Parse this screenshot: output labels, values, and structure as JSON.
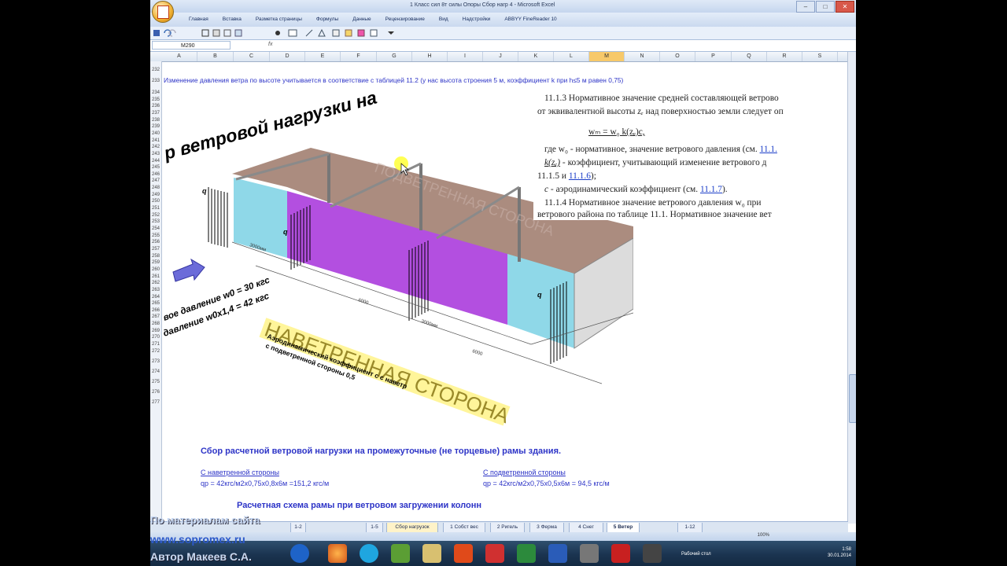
{
  "window": {
    "title": "1 Класс сил 8т силы Опоры Сбор нагр 4 - Microsoft Excel",
    "tabs": [
      "Главная",
      "Вставка",
      "Разметка страницы",
      "Формулы",
      "Данные",
      "Рецензирование",
      "Вид",
      "Надстройки",
      "ABBYY FineReader 10"
    ]
  },
  "formula_bar": {
    "name_box": "M290",
    "fx": "fx",
    "formula": ""
  },
  "columns": [
    "A",
    "B",
    "C",
    "D",
    "E",
    "F",
    "G",
    "H",
    "I",
    "J",
    "K",
    "L",
    "M",
    "N",
    "O",
    "P",
    "Q",
    "R",
    "S"
  ],
  "selected_column": "M",
  "rows": [
    "232",
    "233",
    "234",
    "235",
    "236",
    "237",
    "238",
    "239",
    "240",
    "241",
    "242",
    "243",
    "244",
    "245",
    "246",
    "247",
    "248",
    "249",
    "250",
    "251",
    "252",
    "253",
    "254",
    "255",
    "256",
    "257",
    "258",
    "259",
    "260",
    "261",
    "262",
    "263",
    "264",
    "265",
    "266",
    "267",
    "268",
    "269",
    "270",
    "271",
    "272",
    "273",
    "274",
    "275",
    "276",
    "277"
  ],
  "sheet": {
    "note_233": "Изменение давления ветра по высоте учитывается в соответствие с таблицей 11.2 (у нас высота строения 5 м, коэффициент k при h≤5 м равен 0,75)",
    "figure": {
      "title": "р ветровой нагрузки на",
      "pressure_1": "вое давление w0 = 30 кгс",
      "pressure_2": "давление w0x1,4 = 42 кгс",
      "banner": "НАВЕТРЕННАЯ СТОРОНА",
      "banner_faint": "ПОДВЕТРЕННАЯ СТОРОНА",
      "coef_1": "Аэродинамический коэффициент с с наветр",
      "coef_2": "с подветренной стороны 0,5",
      "dim_3000": "3000мм",
      "dim_6000": "6000",
      "q_label": "q"
    },
    "doc": {
      "p1": "11.1.3 Нормативное значение средней составляющей ветрово",
      "p1b": "от эквивалентной высоты",
      "p1b_var": "zₑ",
      "p1b_tail": "над поверхностью земли следует оп",
      "formula": "wₘ = w₀ k(zₑ)c,",
      "p2": "где w₀ - нормативное, значение ветрового давления (см.",
      "p2_link": "11.1.",
      "p3_var": "k(zₑ)",
      "p3": "- коэффициент, учитывающий изменение ветрового д",
      "p4": "11.1.5 и",
      "p4_link": "11.1.6",
      "p4_tail": ");",
      "p5_pre": "c",
      "p5": "- аэродинамический коэффициент (см.",
      "p5_link": "11.1.7",
      "p5_tail": ").",
      "p6": "11.1.4 Нормативное значение ветрового давления w₀ при",
      "p7": "ветрового района по таблице 11.1. Нормативное значение вет"
    },
    "heading_272": "Сбор расчетной ветровой нагрузки на промежуточные (не торцевые) рамы здания.",
    "left_head": "С наветренной стороны",
    "left_formula": "qр = 42кгс/м2х0,75х0,8х6м =151,2 кгс/м",
    "right_head": "С подветренной стороны",
    "right_formula": "qр = 42кгс/м2х0,75х0,5х6м = 94,5 кгс/м",
    "heading_277": "Расчетная схема рамы при ветровом загружении колонн"
  },
  "sheet_tabs": [
    "1-2",
    "1-5",
    "Сбор нагрузок",
    "1 Собст вес",
    "2 Ригель",
    "3 Ферма",
    "4 Снег",
    "5 Ветер",
    "1-12"
  ],
  "status": {
    "zoom": "100%"
  },
  "taskbar": {
    "desktop_label": "Рабочий стол",
    "time": "1:58",
    "date": "30.01.2014"
  },
  "watermark": {
    "line1": "По материалам сайта",
    "line2": "www.sopromex.ru",
    "line3": "Автор Макеев С.А."
  },
  "colors": {
    "accent": "#2d34c7",
    "wall_cyan": "#8fd8e8",
    "wall_magenta": "#b34fe0",
    "roof": "#9c7868"
  }
}
